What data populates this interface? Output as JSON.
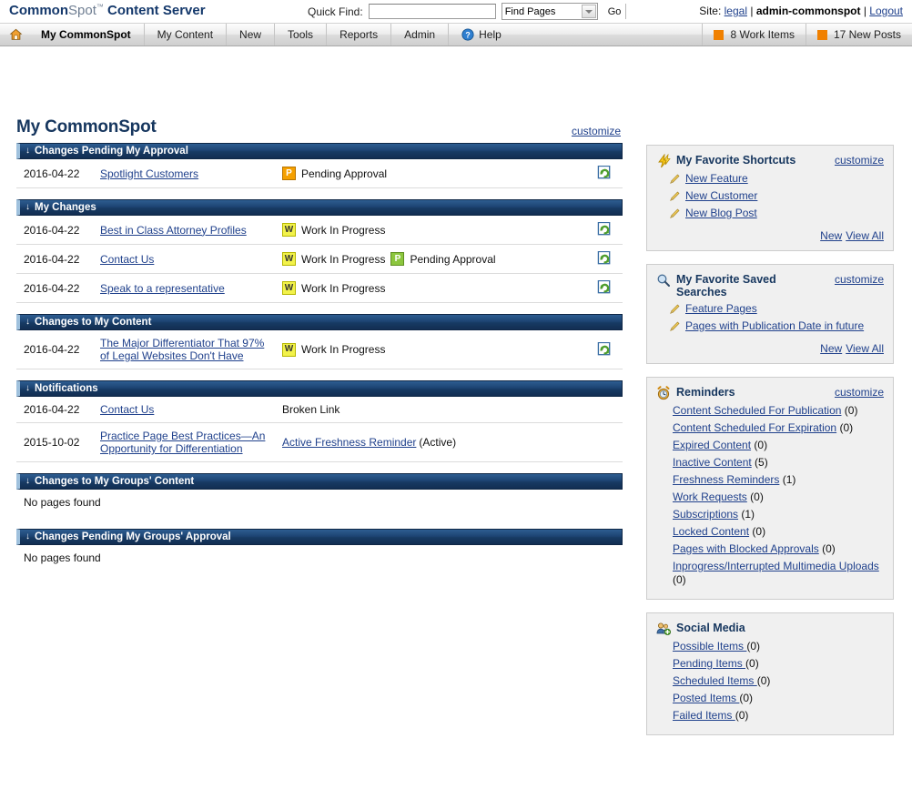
{
  "brand": {
    "common": "Common",
    "spot": "Spot",
    "tm": "™",
    "content_server": " Content Server"
  },
  "header": {
    "quick_find_label": "Quick Find:",
    "quick_find_value": "",
    "quick_find_placeholder": "",
    "scope_selected": "Find Pages",
    "go_label": "Go",
    "site_label": "Site:",
    "site_name": "legal",
    "sep": "|",
    "account": "admin-commonspot",
    "logout": "Logout"
  },
  "nav": {
    "items": [
      {
        "label": "My CommonSpot",
        "active": true
      },
      {
        "label": "My Content",
        "active": false
      },
      {
        "label": "New",
        "active": false
      },
      {
        "label": "Tools",
        "active": false
      },
      {
        "label": "Reports",
        "active": false
      },
      {
        "label": "Admin",
        "active": false
      },
      {
        "label": "Help",
        "active": false
      }
    ],
    "home_icon": "home-icon",
    "help_icon": "help-icon",
    "stats": [
      {
        "label": "8 Work Items",
        "color": "#f08000"
      },
      {
        "label": "17 New Posts",
        "color": "#f08000"
      }
    ]
  },
  "page": {
    "title": "My CommonSpot",
    "customize": "customize"
  },
  "sections": [
    {
      "id": "changes-pending-my-approval",
      "title": "Changes Pending My Approval",
      "caret": "↓",
      "empty_text": null,
      "rows": [
        {
          "date": "2016-04-22",
          "title": "Spotlight Customers",
          "statuses": [
            {
              "badge": "P",
              "badge_kind": "p-orange",
              "text": "Pending Approval"
            }
          ],
          "action_icon": "page-refresh-icon"
        }
      ]
    },
    {
      "id": "my-changes",
      "title": "My Changes",
      "caret": "↓",
      "empty_text": null,
      "rows": [
        {
          "date": "2016-04-22",
          "title": "Best in Class Attorney Profiles",
          "statuses": [
            {
              "badge": "W",
              "badge_kind": "w",
              "text": "Work In Progress"
            }
          ],
          "action_icon": "page-refresh-icon"
        },
        {
          "date": "2016-04-22",
          "title": "Contact Us",
          "statuses": [
            {
              "badge": "W",
              "badge_kind": "w",
              "text": "Work In Progress"
            },
            {
              "badge": "P",
              "badge_kind": "p-green",
              "text": "Pending Approval"
            }
          ],
          "action_icon": "page-refresh-icon"
        },
        {
          "date": "2016-04-22",
          "title": "Speak to a representative",
          "statuses": [
            {
              "badge": "W",
              "badge_kind": "w",
              "text": "Work In Progress"
            }
          ],
          "action_icon": "page-refresh-icon"
        }
      ]
    },
    {
      "id": "changes-to-my-content",
      "title": "Changes to My Content",
      "caret": "↓",
      "empty_text": null,
      "rows": [
        {
          "date": "2016-04-22",
          "title": "The Major Differentiator That 97% of Legal Websites Don't Have",
          "statuses": [
            {
              "badge": "W",
              "badge_kind": "w",
              "text": "Work In Progress"
            }
          ],
          "action_icon": "page-refresh-icon"
        }
      ]
    },
    {
      "id": "notifications",
      "title": "Notifications",
      "caret": "↓",
      "empty_text": null,
      "rows": [
        {
          "date": "2016-04-22",
          "title": "Contact Us",
          "statuses": [
            {
              "badge": null,
              "badge_kind": null,
              "text": "Broken Link"
            }
          ],
          "action_icon": null
        },
        {
          "date": "2015-10-02",
          "title": "Practice Page Best Practices—An Opportunity for Differentiation",
          "statuses": [
            {
              "badge": null,
              "badge_kind": null,
              "text": "Active Freshness Reminder",
              "link": true,
              "suffix": "(Active)"
            }
          ],
          "action_icon": null
        }
      ]
    },
    {
      "id": "changes-to-my-groups-content",
      "title": "Changes to My Groups' Content",
      "caret": "↓",
      "empty_text": "No pages found",
      "rows": []
    },
    {
      "id": "changes-pending-my-groups-approval",
      "title": "Changes Pending My Groups' Approval",
      "caret": "↓",
      "empty_text": "No pages found",
      "rows": []
    }
  ],
  "panels": [
    {
      "id": "favorite-shortcuts",
      "icon": "lightning-bolt-icon",
      "title": "My Favorite Shortcuts",
      "customize": "customize",
      "item_icon": "pencil-icon",
      "items": [
        {
          "label": "New Feature"
        },
        {
          "label": "New Customer"
        },
        {
          "label": "New Blog Post"
        }
      ],
      "footer": [
        "New",
        "View All"
      ]
    },
    {
      "id": "favorite-saved-searches",
      "icon": "magnifier-icon",
      "title": "My Favorite Saved Searches",
      "customize": "customize",
      "item_icon": "pencil-icon",
      "items": [
        {
          "label": "Feature Pages"
        },
        {
          "label": "Pages with Publication Date in future"
        }
      ],
      "footer": [
        "New",
        "View All"
      ]
    },
    {
      "id": "reminders",
      "icon": "alarm-clock-icon",
      "title": "Reminders",
      "customize": "customize",
      "item_icon": null,
      "items": [
        {
          "label": "Content Scheduled For Publication",
          "count": "(0)"
        },
        {
          "label": "Content Scheduled For Expiration",
          "count": "(0)"
        },
        {
          "label": "Expired Content",
          "count": "(0)"
        },
        {
          "label": "Inactive Content",
          "count": "(5)"
        },
        {
          "label": "Freshness Reminders",
          "count": "(1)"
        },
        {
          "label": "Work Requests",
          "count": "(0)"
        },
        {
          "label": "Subscriptions",
          "count": "(1)"
        },
        {
          "label": "Locked Content",
          "count": "(0)"
        },
        {
          "label": "Pages with Blocked Approvals",
          "count": "(0)"
        },
        {
          "label": "Inprogress/Interrupted Multimedia Uploads",
          "count": "(0)"
        }
      ],
      "footer": []
    },
    {
      "id": "social-media",
      "icon": "users-add-icon",
      "title": "Social Media",
      "customize": null,
      "item_icon": null,
      "items": [
        {
          "label": "Possible Items ",
          "count": "(0)"
        },
        {
          "label": "Pending Items ",
          "count": "(0)"
        },
        {
          "label": "Scheduled Items ",
          "count": "(0)"
        },
        {
          "label": "Posted Items ",
          "count": "(0)"
        },
        {
          "label": "Failed Items ",
          "count": "(0)"
        }
      ],
      "footer": []
    }
  ],
  "colors": {
    "accent_orange": "#f08000",
    "header_blue": "#1d4473",
    "link_blue": "#20418c",
    "title_blue": "#16365e",
    "badge_w": "#f2f24a",
    "badge_p_orange": "#f5a000",
    "badge_p_green": "#8cc63e"
  }
}
